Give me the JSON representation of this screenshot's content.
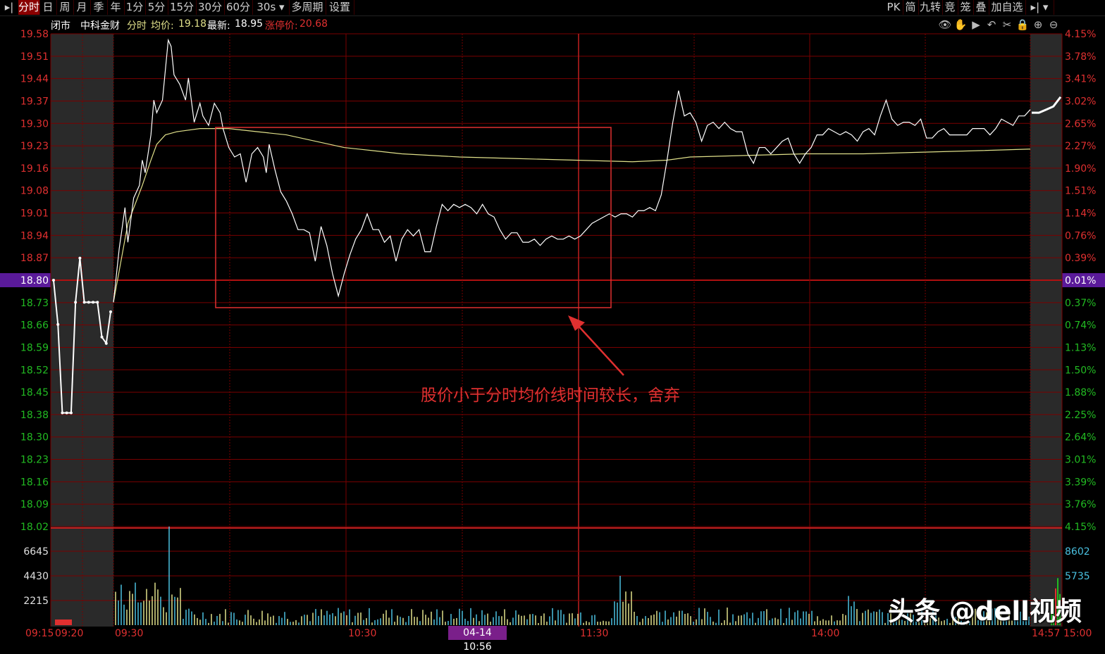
{
  "toolbar": {
    "left_items": [
      "分时",
      "日",
      "周",
      "月",
      "季",
      "年",
      "1分",
      "5分",
      "15分",
      "30分",
      "60分",
      "30s",
      "多周期",
      "设置"
    ],
    "right_items": [
      "PK",
      "简",
      "九转",
      "竞",
      "笼",
      "叠",
      "加自选"
    ],
    "active": "分时"
  },
  "info": {
    "status": "闭市",
    "name": "中科金财",
    "mode": "分时",
    "avg_label": "均价:",
    "avg_value": "19.18",
    "latest_label": "最新:",
    "latest_value": "18.95",
    "limit_label": "涨停价:",
    "limit_value": "20.68"
  },
  "icons": [
    "eye-icon",
    "hand-icon",
    "play-icon",
    "undo-icon",
    "scissors-icon",
    "lock-icon",
    "zoom-in-icon",
    "zoom-out-icon"
  ],
  "annotation": "股价小于分时均价线时间较长，舍弃",
  "watermark": "头条 @dell视频",
  "cursor_time": "04-14 10:56",
  "colors": {
    "up": "#e03030",
    "down": "#22bb22",
    "price_line": "#ffffff",
    "avg_line": "#e0e08a",
    "grid": "#7a0000",
    "highlight": "#5a1a9a",
    "annot_box": "#e03030"
  },
  "chart_data": {
    "type": "line",
    "prev_close": 18.8,
    "y_left_ticks": [
      "19.58",
      "19.51",
      "19.44",
      "19.37",
      "19.30",
      "19.23",
      "19.16",
      "19.08",
      "19.01",
      "18.94",
      "18.87",
      "18.80",
      "18.73",
      "18.66",
      "18.59",
      "18.52",
      "18.45",
      "18.38",
      "18.30",
      "18.23",
      "18.16",
      "18.09",
      "18.02"
    ],
    "y_right_ticks": [
      "4.15%",
      "3.78%",
      "3.41%",
      "3.02%",
      "2.65%",
      "2.27%",
      "1.90%",
      "1.51%",
      "1.14%",
      "0.76%",
      "0.39%",
      "0.01%",
      "0.37%",
      "0.74%",
      "1.13%",
      "1.50%",
      "1.88%",
      "2.25%",
      "2.64%",
      "3.01%",
      "3.39%",
      "3.76%",
      "4.15%"
    ],
    "ylim": [
      18.02,
      19.58
    ],
    "x_ticks": [
      "09:15",
      "09:20",
      "09:30",
      "10:30",
      "11:30",
      "14:00",
      "14:57",
      "15:00"
    ],
    "volume_ticks_left": [
      "6645",
      "4430",
      "2215"
    ],
    "volume_ticks_right": [
      "8602",
      "5735"
    ],
    "auction_price": [
      [
        0,
        18.8
      ],
      [
        1,
        18.66
      ],
      [
        2,
        18.38
      ],
      [
        3,
        18.38
      ],
      [
        4,
        18.38
      ],
      [
        5,
        18.73
      ],
      [
        6,
        18.87
      ],
      [
        7,
        18.73
      ],
      [
        8,
        18.73
      ],
      [
        9,
        18.73
      ],
      [
        10,
        18.73
      ],
      [
        11,
        18.62
      ],
      [
        12,
        18.6
      ],
      [
        13,
        18.7
      ]
    ],
    "series": [
      {
        "name": "price",
        "points": [
          [
            0,
            18.73
          ],
          [
            4,
            18.9
          ],
          [
            8,
            19.03
          ],
          [
            10,
            18.92
          ],
          [
            14,
            19.06
          ],
          [
            18,
            19.1
          ],
          [
            20,
            19.18
          ],
          [
            22,
            19.14
          ],
          [
            26,
            19.26
          ],
          [
            28,
            19.37
          ],
          [
            30,
            19.33
          ],
          [
            34,
            19.37
          ],
          [
            38,
            19.56
          ],
          [
            40,
            19.54
          ],
          [
            42,
            19.45
          ],
          [
            46,
            19.42
          ],
          [
            50,
            19.37
          ],
          [
            52,
            19.44
          ],
          [
            56,
            19.3
          ],
          [
            60,
            19.36
          ],
          [
            62,
            19.32
          ],
          [
            66,
            19.29
          ],
          [
            70,
            19.36
          ],
          [
            74,
            19.33
          ],
          [
            76,
            19.28
          ],
          [
            80,
            19.22
          ],
          [
            84,
            19.19
          ],
          [
            88,
            19.2
          ],
          [
            92,
            19.11
          ],
          [
            96,
            19.2
          ],
          [
            100,
            19.22
          ],
          [
            104,
            19.19
          ],
          [
            106,
            19.14
          ],
          [
            108,
            19.23
          ],
          [
            112,
            19.15
          ],
          [
            116,
            19.08
          ],
          [
            120,
            19.05
          ],
          [
            124,
            19.01
          ],
          [
            128,
            18.96
          ],
          [
            132,
            18.96
          ],
          [
            136,
            18.95
          ],
          [
            140,
            18.86
          ],
          [
            144,
            18.97
          ],
          [
            148,
            18.91
          ],
          [
            152,
            18.82
          ],
          [
            156,
            18.75
          ],
          [
            160,
            18.82
          ],
          [
            164,
            18.88
          ],
          [
            168,
            18.93
          ],
          [
            172,
            18.96
          ],
          [
            176,
            19.01
          ],
          [
            180,
            18.96
          ],
          [
            184,
            18.96
          ],
          [
            188,
            18.92
          ],
          [
            192,
            18.94
          ],
          [
            196,
            18.86
          ],
          [
            200,
            18.93
          ],
          [
            204,
            18.96
          ],
          [
            208,
            18.94
          ],
          [
            212,
            18.96
          ],
          [
            216,
            18.89
          ],
          [
            220,
            18.89
          ],
          [
            224,
            18.97
          ],
          [
            228,
            19.04
          ],
          [
            232,
            19.02
          ],
          [
            236,
            19.04
          ],
          [
            240,
            19.03
          ],
          [
            244,
            19.04
          ],
          [
            248,
            19.03
          ],
          [
            252,
            19.01
          ],
          [
            256,
            19.04
          ],
          [
            260,
            19.01
          ],
          [
            264,
            19.0
          ],
          [
            268,
            18.96
          ],
          [
            272,
            18.93
          ],
          [
            276,
            18.95
          ],
          [
            280,
            18.95
          ],
          [
            284,
            18.92
          ],
          [
            288,
            18.92
          ],
          [
            292,
            18.93
          ],
          [
            296,
            18.91
          ],
          [
            300,
            18.93
          ],
          [
            304,
            18.94
          ],
          [
            308,
            18.93
          ],
          [
            312,
            18.93
          ],
          [
            316,
            18.94
          ],
          [
            320,
            18.93
          ],
          [
            324,
            18.94
          ],
          [
            328,
            18.96
          ],
          [
            332,
            18.98
          ],
          [
            336,
            18.99
          ],
          [
            340,
            19.0
          ],
          [
            344,
            19.01
          ],
          [
            348,
            19.0
          ],
          [
            352,
            19.01
          ],
          [
            356,
            19.01
          ],
          [
            360,
            19.0
          ],
          [
            364,
            19.02
          ],
          [
            368,
            19.02
          ],
          [
            372,
            19.03
          ],
          [
            376,
            19.02
          ],
          [
            380,
            19.07
          ],
          [
            384,
            19.18
          ],
          [
            388,
            19.3
          ],
          [
            392,
            19.4
          ],
          [
            396,
            19.32
          ],
          [
            400,
            19.33
          ],
          [
            404,
            19.3
          ],
          [
            408,
            19.24
          ],
          [
            412,
            19.29
          ],
          [
            416,
            19.3
          ],
          [
            420,
            19.28
          ],
          [
            424,
            19.3
          ],
          [
            428,
            19.28
          ],
          [
            432,
            19.27
          ],
          [
            436,
            19.27
          ],
          [
            440,
            19.2
          ],
          [
            444,
            19.17
          ],
          [
            448,
            19.22
          ],
          [
            452,
            19.22
          ],
          [
            456,
            19.2
          ],
          [
            460,
            19.22
          ],
          [
            464,
            19.24
          ],
          [
            468,
            19.25
          ],
          [
            472,
            19.2
          ],
          [
            476,
            19.17
          ],
          [
            480,
            19.2
          ],
          [
            484,
            19.22
          ],
          [
            488,
            19.26
          ],
          [
            492,
            19.26
          ],
          [
            496,
            19.28
          ],
          [
            500,
            19.27
          ],
          [
            504,
            19.26
          ],
          [
            508,
            19.27
          ],
          [
            512,
            19.26
          ],
          [
            516,
            19.24
          ],
          [
            520,
            19.27
          ],
          [
            524,
            19.28
          ],
          [
            528,
            19.26
          ],
          [
            532,
            19.32
          ],
          [
            536,
            19.37
          ],
          [
            540,
            19.31
          ],
          [
            544,
            19.29
          ],
          [
            548,
            19.3
          ],
          [
            552,
            19.3
          ],
          [
            556,
            19.29
          ],
          [
            560,
            19.31
          ],
          [
            564,
            19.25
          ],
          [
            568,
            19.25
          ],
          [
            572,
            19.27
          ],
          [
            576,
            19.28
          ],
          [
            580,
            19.26
          ],
          [
            584,
            19.26
          ],
          [
            588,
            19.26
          ],
          [
            592,
            19.26
          ],
          [
            596,
            19.28
          ],
          [
            600,
            19.28
          ],
          [
            604,
            19.28
          ],
          [
            608,
            19.26
          ],
          [
            612,
            19.28
          ],
          [
            616,
            19.31
          ],
          [
            620,
            19.3
          ],
          [
            624,
            19.29
          ],
          [
            628,
            19.32
          ],
          [
            632,
            19.32
          ],
          [
            636,
            19.34
          ]
        ]
      },
      {
        "name": "avg",
        "points": [
          [
            0,
            18.73
          ],
          [
            10,
            18.98
          ],
          [
            20,
            19.1
          ],
          [
            26,
            19.18
          ],
          [
            30,
            19.23
          ],
          [
            36,
            19.26
          ],
          [
            44,
            19.27
          ],
          [
            60,
            19.28
          ],
          [
            80,
            19.28
          ],
          [
            100,
            19.27
          ],
          [
            120,
            19.26
          ],
          [
            140,
            19.24
          ],
          [
            160,
            19.22
          ],
          [
            180,
            19.21
          ],
          [
            200,
            19.2
          ],
          [
            240,
            19.19
          ],
          [
            280,
            19.185
          ],
          [
            320,
            19.18
          ],
          [
            360,
            19.175
          ],
          [
            384,
            19.18
          ],
          [
            400,
            19.19
          ],
          [
            440,
            19.195
          ],
          [
            480,
            19.2
          ],
          [
            520,
            19.2
          ],
          [
            560,
            19.205
          ],
          [
            600,
            19.21
          ],
          [
            636,
            19.215
          ]
        ]
      }
    ],
    "close_auction_price": [
      [
        0,
        19.33
      ],
      [
        4,
        19.33
      ],
      [
        8,
        19.34
      ],
      [
        12,
        19.35
      ],
      [
        16,
        19.38
      ]
    ]
  }
}
